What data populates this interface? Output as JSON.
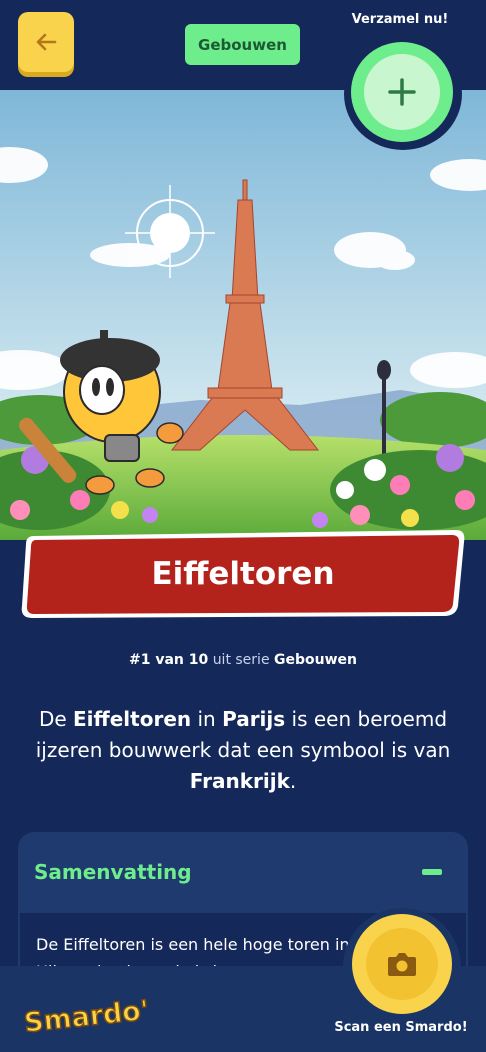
{
  "header": {
    "chip_label": "Gebouwen",
    "collect_label": "Verzamel nu!"
  },
  "card": {
    "title": "Eiffeltoren",
    "series": {
      "number": "#1 van 10",
      "middle": "uit serie",
      "name": "Gebouwen"
    },
    "description": {
      "p1": "De ",
      "b1": "Eiffeltoren",
      "p2": " in ",
      "b2": "Parijs",
      "p3": " is een beroemd ijzeren bouwwerk dat een symbool is van ",
      "b3": "Frankrijk",
      "p4": "."
    }
  },
  "summary": {
    "title": "Samenvatting",
    "text": "De Eiffeltoren is een hele hoge toren in Frankrijk. Hij werd gebouwd als ingang"
  },
  "bottom": {
    "logo_text": "Smardo's",
    "scan_label": "Scan een Smardo!"
  },
  "colors": {
    "background": "#14285a",
    "accent_green": "#6eed8c",
    "accent_yellow": "#f8d34b",
    "banner_red": "#b3231c"
  },
  "icons": [
    "arrow-left-icon",
    "plus-icon",
    "minus-icon",
    "camera-icon"
  ]
}
